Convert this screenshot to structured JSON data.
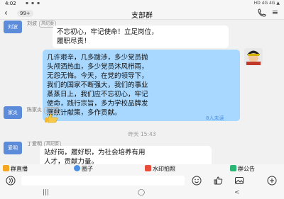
{
  "status_bar": {
    "time": "4:02",
    "signal_text": "HD 4G 4G ▲"
  },
  "header": {
    "back_glyph": "‹",
    "unread_badge": "99+",
    "title": "支部群",
    "menu_glyph": "≡"
  },
  "messages": [
    {
      "sender_avatar_text": "刘波",
      "sender_name": "刘波",
      "role": "风纪委",
      "text": [
        "不忘初心，牢记使命！立足岗位，",
        "履职尽责！"
      ]
    },
    {
      "self": true,
      "text": [
        "几许艰辛，几多跋涉，多少党员抛",
        "头颅洒热血，多少党员沐风栉雨，",
        "无怨无悔。今天，在党的领导下，",
        "我们的国家不断强大，我们的事业",
        "蒸蒸日上，我们应不忘初心，牢记",
        "使命，践行宗旨，多为学校品牌发",
        "展献计献策，多作贡献。"
      ],
      "read_count": "8人未读"
    },
    {
      "sender_avatar_text": "家炎",
      "sender_name": "陈家炎",
      "role": "风纪委",
      "sticker": "thumbs-up"
    },
    {
      "timestamp": "昨天 15:43"
    },
    {
      "sender_avatar_text": "爱明",
      "sender_name": "丁爱明",
      "role": "风纪委",
      "text": [
        "站好岗，履好职，为社会培养有用",
        "人才，贡献力量。"
      ]
    }
  ],
  "toolbar": [
    {
      "label": "群直播",
      "icon": "live-icon",
      "color": "#f5a623"
    },
    {
      "label": "圈子",
      "icon": "circle-icon",
      "color": "#4a90e2"
    },
    {
      "label": "水印拍照",
      "icon": "camera-icon",
      "color": "#e94e3c"
    },
    {
      "label": "群公告",
      "icon": "announcement-icon",
      "color": "#2bb673"
    }
  ],
  "colors": {
    "self_bubble": "#a8d8ff",
    "avatar_blue": "#5b8bd9",
    "link_blue": "#4a90e2"
  }
}
